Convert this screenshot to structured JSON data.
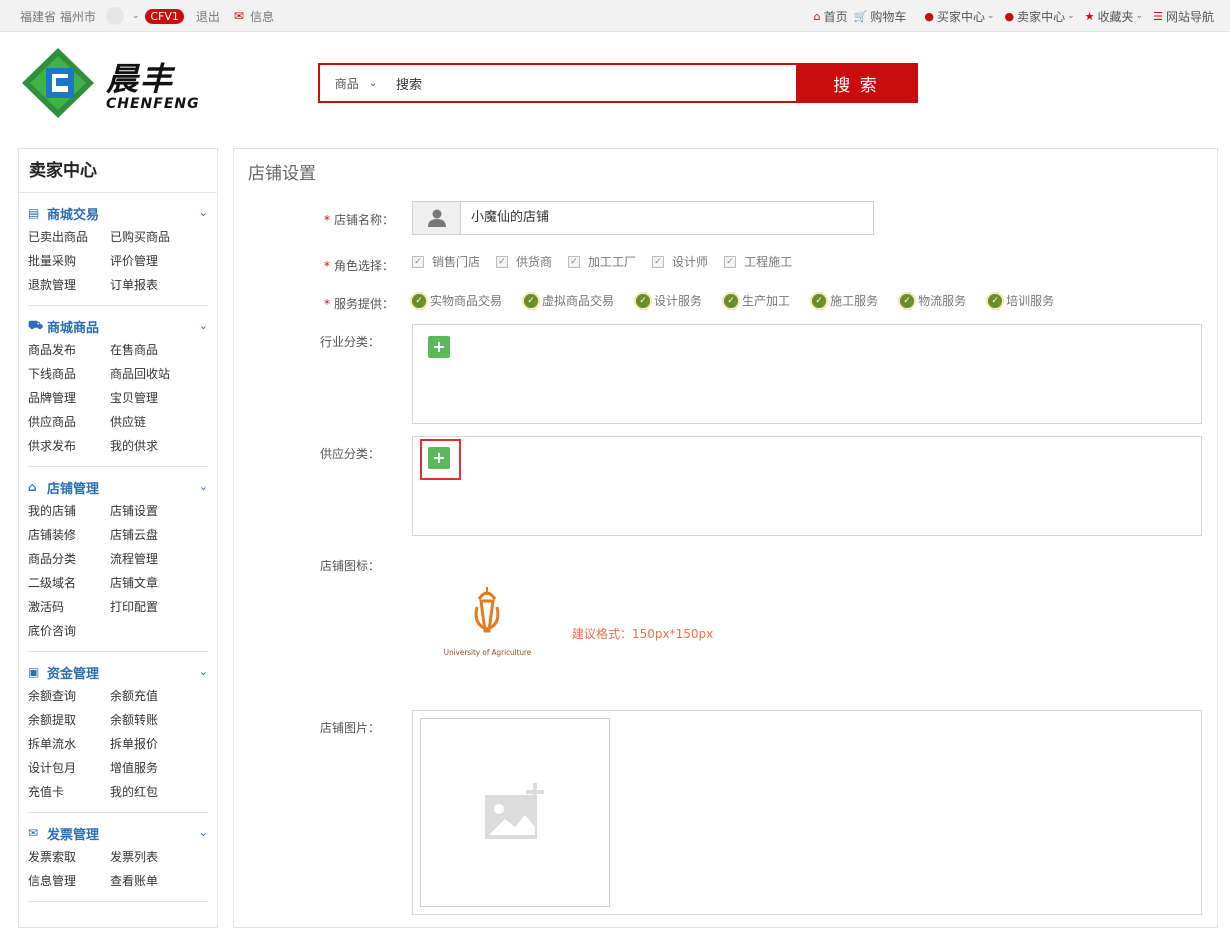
{
  "topbar": {
    "location": "福建省 福州市",
    "level_badge": "CFV1",
    "logout": "退出",
    "messages": "信息",
    "home": "首页",
    "cart": "购物车",
    "buyer_center": "买家中心",
    "seller_center": "卖家中心",
    "favorites": "收藏夹",
    "site_nav": "网站导航"
  },
  "logo": {
    "cn": "晨丰",
    "en": "CHENFENG"
  },
  "search": {
    "category": "商品",
    "value": "搜索",
    "button": "搜 索"
  },
  "sidebar": {
    "title": "卖家中心",
    "groups": [
      {
        "title": "商城交易",
        "icon": "card-icon",
        "links": [
          "已卖出商品",
          "已购买商品",
          "批量采购",
          "评价管理",
          "退款管理",
          "订单报表"
        ]
      },
      {
        "title": "商城商品",
        "icon": "truck-icon",
        "links": [
          "商品发布",
          "在售商品",
          "下线商品",
          "商品回收站",
          "品牌管理",
          "宝贝管理",
          "供应商品",
          "供应链",
          "供求发布",
          "我的供求"
        ]
      },
      {
        "title": "店铺管理",
        "icon": "home-icon",
        "links": [
          "我的店铺",
          "店铺设置",
          "店铺装修",
          "店铺云盘",
          "商品分类",
          "流程管理",
          "二级域名",
          "店铺文章",
          "激活码",
          "打印配置",
          "底价咨询"
        ]
      },
      {
        "title": "资金管理",
        "icon": "money-icon",
        "links": [
          "余额查询",
          "余额充值",
          "余额提取",
          "余额转账",
          "拆单流水",
          "拆单报价",
          "设计包月",
          "增值服务",
          "充值卡",
          "我的红包"
        ]
      },
      {
        "title": "发票管理",
        "icon": "envelope-icon",
        "links": [
          "发票索取",
          "发票列表",
          "信息管理",
          "查看账单"
        ]
      }
    ]
  },
  "main": {
    "title": "店铺设置",
    "labels": {
      "shop_name": "店铺名称：",
      "role": "角色选择：",
      "service": "服务提供：",
      "industry": "行业分类：",
      "supply": "供应分类：",
      "shop_icon": "店铺图标：",
      "shop_image": "店铺图片："
    },
    "shop_name_value": "小魔仙的店铺",
    "roles": [
      "销售门店",
      "供货商",
      "加工工厂",
      "设计师",
      "工程施工"
    ],
    "services": [
      "实物商品交易",
      "虚拟商品交易",
      "设计服务",
      "生产加工",
      "施工服务",
      "物流服务",
      "培训服务"
    ],
    "icon_caption": "University of Agriculture",
    "icon_hint": "建议格式：150px*150px",
    "colors": {
      "accent": "#c90d0d",
      "link": "#2a6eb3",
      "add_button": "#5cb85c",
      "hint": "#e8734a"
    }
  }
}
